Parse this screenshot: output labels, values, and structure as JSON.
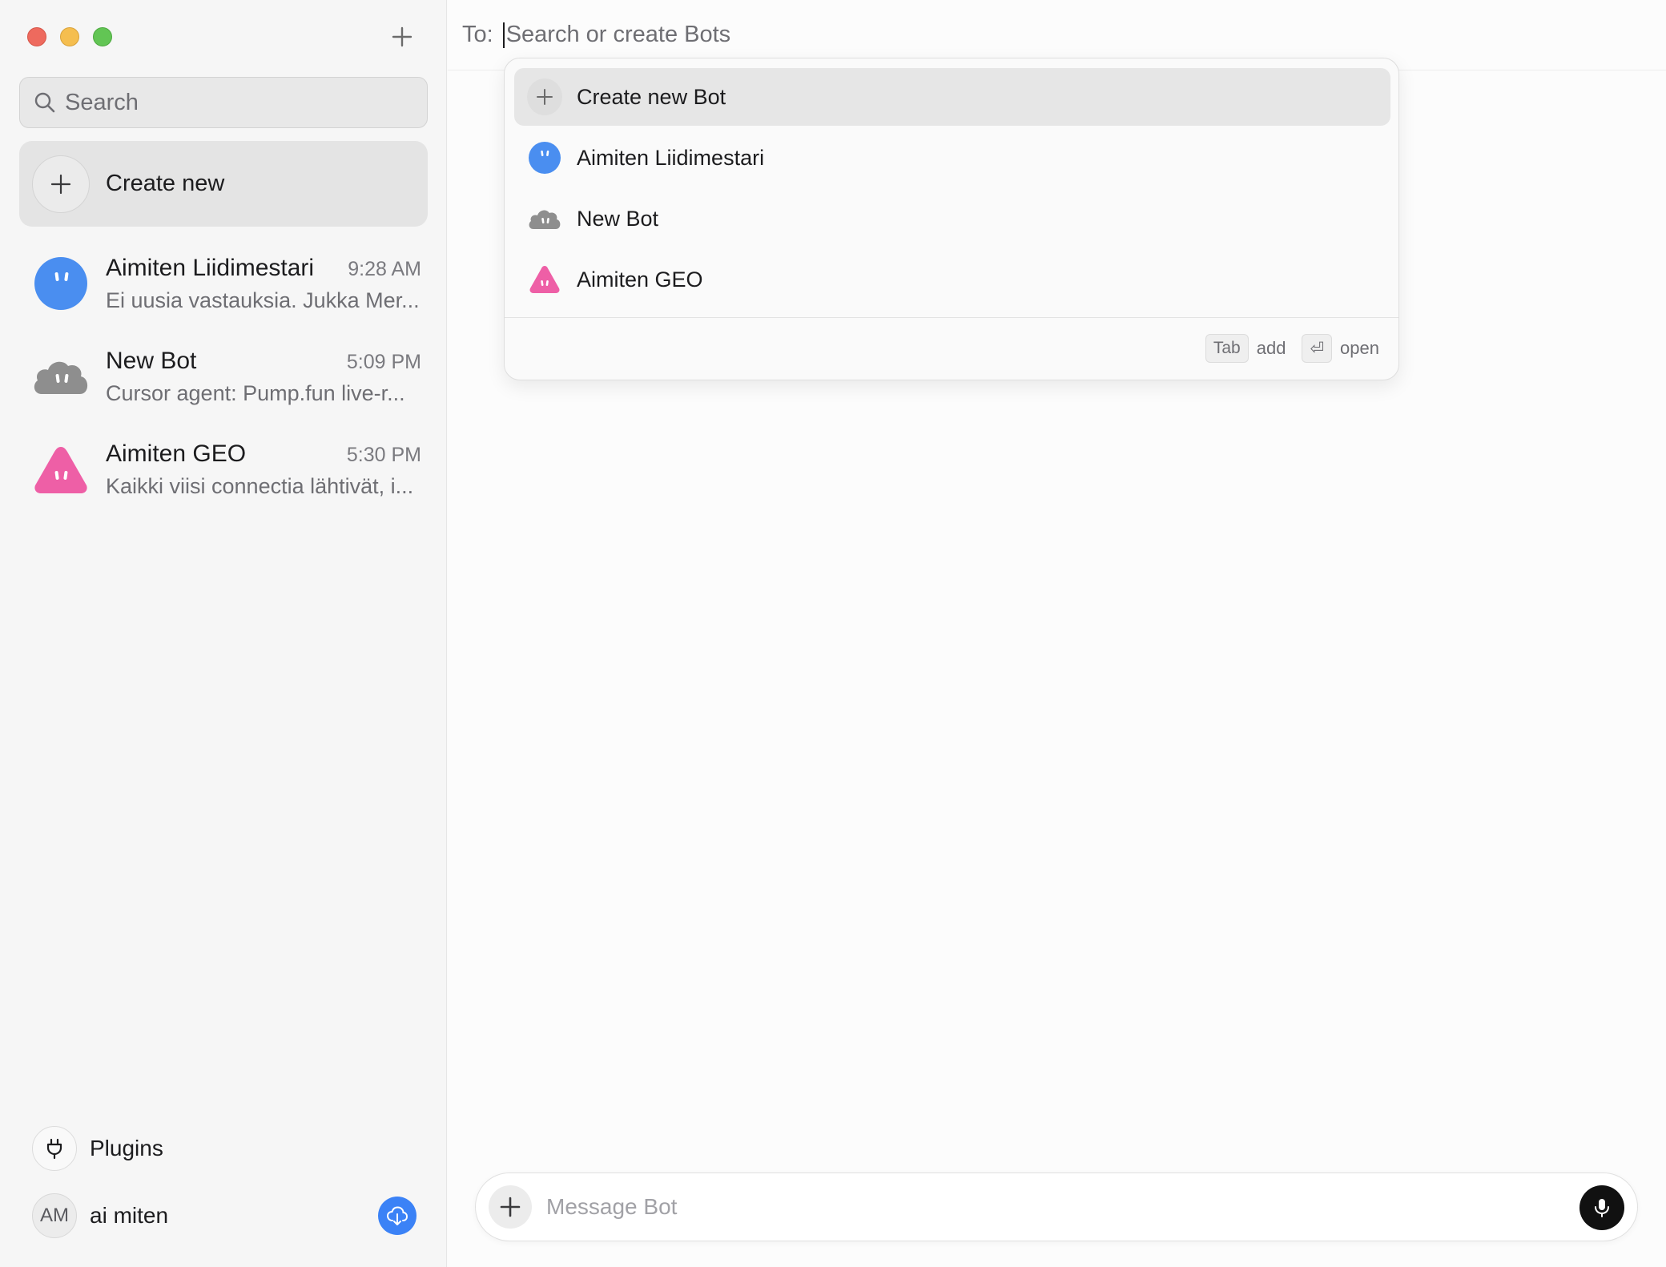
{
  "sidebar": {
    "search_placeholder": "Search",
    "create_new_label": "Create new",
    "chats": [
      {
        "name": "Aimiten Liidimestari",
        "time": "9:28 AM",
        "preview": "Ei uusia vastauksia. Jukka Mer...",
        "avatar": "blue-round-bot-icon",
        "color": "#4a8ef0"
      },
      {
        "name": "New Bot",
        "time": "5:09 PM",
        "preview": "Cursor agent: Pump.fun live-r...",
        "avatar": "gray-cloud-bot-icon",
        "color": "#8e8e8e"
      },
      {
        "name": "Aimiten GEO",
        "time": "5:30 PM",
        "preview": "Kaikki viisi connectia lähtivät, i...",
        "avatar": "pink-triangle-bot-icon",
        "color": "#ee5fa6"
      }
    ],
    "plugins_label": "Plugins",
    "profile": {
      "initials": "AM",
      "name": "ai miten"
    }
  },
  "main": {
    "to_label": "To:",
    "to_placeholder": "Search or create Bots",
    "dropdown": {
      "items": [
        {
          "label": "Create new Bot",
          "icon": "plus-icon"
        },
        {
          "label": "Aimiten Liidimestari",
          "icon": "blue-round-bot-icon"
        },
        {
          "label": "New Bot",
          "icon": "gray-cloud-bot-icon"
        },
        {
          "label": "Aimiten GEO",
          "icon": "pink-triangle-bot-icon"
        }
      ],
      "footer": {
        "tab_key": "Tab",
        "tab_hint": "add",
        "enter_key": "⏎",
        "enter_hint": "open"
      }
    },
    "composer_placeholder": "Message Bot"
  },
  "colors": {
    "accent": "#3b82f6",
    "blue_bot": "#4a8ef0",
    "gray_bot": "#8e8e8e",
    "pink_bot": "#ee5fa6"
  }
}
